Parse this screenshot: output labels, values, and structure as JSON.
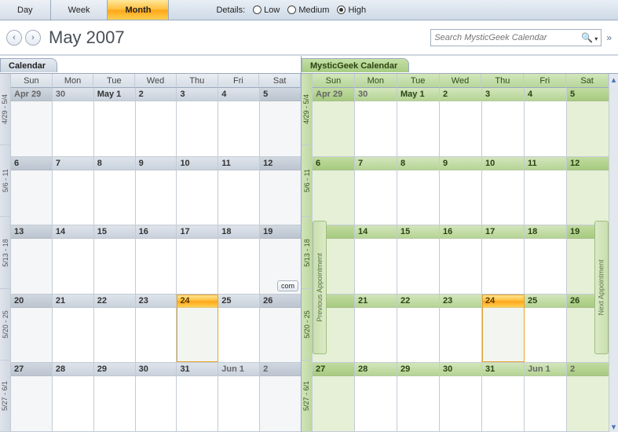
{
  "toolbar": {
    "views": [
      "Day",
      "Week",
      "Month"
    ],
    "active_view": 2,
    "details_label": "Details:",
    "detail_levels": [
      "Low",
      "Medium",
      "High"
    ],
    "detail_selected": 2
  },
  "nav": {
    "back_icon": "‹",
    "forward_icon": "›",
    "title": "May 2007",
    "expand_icon": "»"
  },
  "search": {
    "placeholder": "Search MysticGeek Calendar"
  },
  "panes": [
    {
      "id": 0,
      "theme": "gray",
      "title": "Calendar"
    },
    {
      "id": 1,
      "theme": "green",
      "title": "MysticGeek Calendar"
    }
  ],
  "appt_handles": {
    "prev": "Previous Appointment",
    "next": "Next Appointment"
  },
  "dow": [
    "Sun",
    "Mon",
    "Tue",
    "Wed",
    "Thu",
    "Fri",
    "Sat"
  ],
  "week_labels": [
    "4/29 - 5/4",
    "5/6 - 11",
    "5/13 - 18",
    "5/20 - 25",
    "5/27 - 6/1"
  ],
  "weeks": [
    [
      {
        "label": "Apr 29",
        "weekend": true,
        "outside": true
      },
      {
        "label": "30",
        "outside": true
      },
      {
        "label": "May 1"
      },
      {
        "label": "2"
      },
      {
        "label": "3"
      },
      {
        "label": "4"
      },
      {
        "label": "5",
        "weekend": true
      }
    ],
    [
      {
        "label": "6",
        "weekend": true
      },
      {
        "label": "7"
      },
      {
        "label": "8"
      },
      {
        "label": "9"
      },
      {
        "label": "10"
      },
      {
        "label": "11"
      },
      {
        "label": "12",
        "weekend": true
      }
    ],
    [
      {
        "label": "13",
        "weekend": true
      },
      {
        "label": "14"
      },
      {
        "label": "15"
      },
      {
        "label": "16"
      },
      {
        "label": "17"
      },
      {
        "label": "18"
      },
      {
        "label": "19",
        "weekend": true,
        "badge": "com"
      }
    ],
    [
      {
        "label": "20",
        "weekend": true
      },
      {
        "label": "21"
      },
      {
        "label": "22"
      },
      {
        "label": "23"
      },
      {
        "label": "24",
        "today": true
      },
      {
        "label": "25"
      },
      {
        "label": "26",
        "weekend": true
      }
    ],
    [
      {
        "label": "27",
        "weekend": true
      },
      {
        "label": "28"
      },
      {
        "label": "29"
      },
      {
        "label": "30"
      },
      {
        "label": "31"
      },
      {
        "label": "Jun 1",
        "outside": true
      },
      {
        "label": "2",
        "weekend": true,
        "outside": true
      }
    ]
  ]
}
